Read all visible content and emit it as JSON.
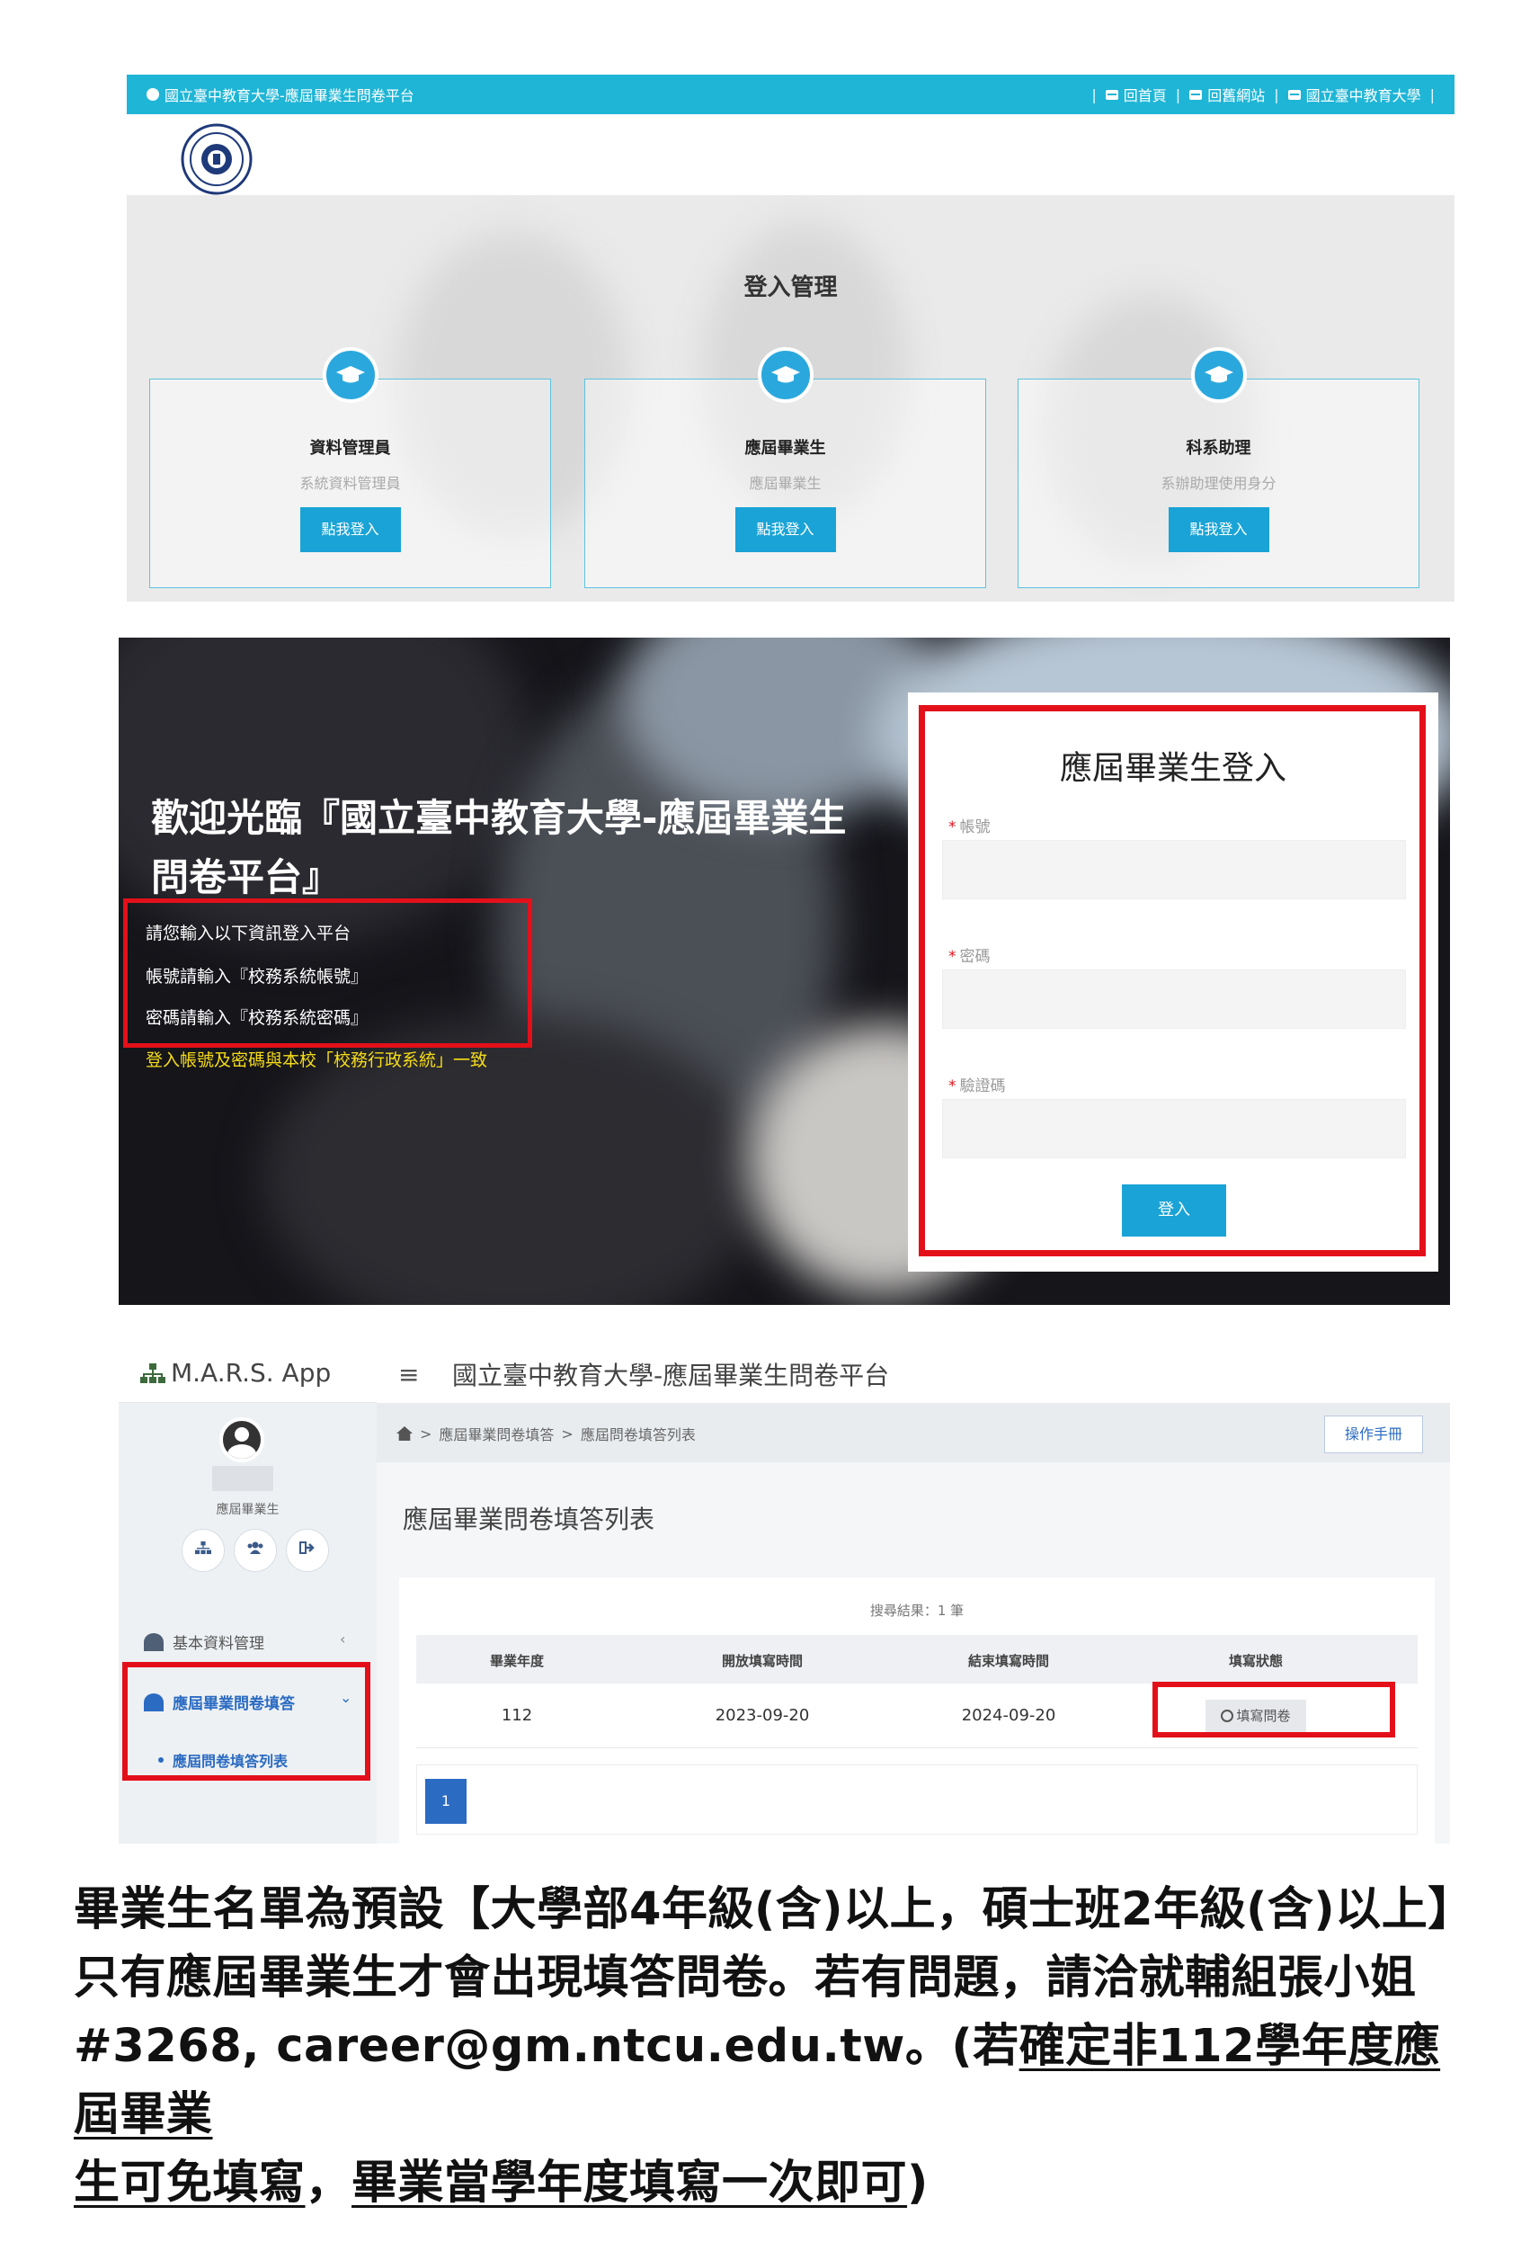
{
  "portal": {
    "site_title": "國立臺中教育大學-應屆畢業生問卷平台",
    "top_links": [
      "回首頁",
      "回舊網站",
      "國立臺中教育大學"
    ],
    "section_title": "登入管理",
    "cards": [
      {
        "title": "資料管理員",
        "subtitle": "系統資料管理員",
        "button": "點我登入"
      },
      {
        "title": "應屆畢業生",
        "subtitle": "應屆畢業生",
        "button": "點我登入"
      },
      {
        "title": "科系助理",
        "subtitle": "系辦助理使用身分",
        "button": "點我登入"
      }
    ]
  },
  "login": {
    "welcome": "歡迎光臨『國立臺中教育大學-應屆畢業生問卷平台』",
    "info": [
      "請您輸入以下資訊登入平台",
      "帳號請輸入『校務系統帳號』",
      "密碼請輸入『校務系統密碼』",
      "登入帳號及密碼與本校「校務行政系統」一致"
    ],
    "panel_title": "應屆畢業生登入",
    "fields": [
      {
        "label": "帳號",
        "value": ""
      },
      {
        "label": "密碼",
        "value": ""
      },
      {
        "label": "驗證碼",
        "value": ""
      }
    ],
    "button": "登入"
  },
  "app": {
    "brand": "M.A.R.S. App",
    "title": "國立臺中教育大學-應屆畢業生問卷平台",
    "role": "應屆畢業生",
    "menu": [
      "基本資料管理",
      "應屆畢業問卷填答"
    ],
    "submenu": "應屆問卷填答列表",
    "breadcrumb": [
      "應屆畢業問卷填答",
      "應屆問卷填答列表"
    ],
    "manual_button": "操作手冊",
    "page_title": "應屆畢業問卷填答列表",
    "result_text": "搜尋結果：1 筆",
    "columns": [
      "畢業年度",
      "開放填寫時間",
      "結束填寫時間",
      "填寫狀態"
    ],
    "rows": [
      {
        "year": "112",
        "open": "2023-09-20",
        "close": "2024-09-20",
        "action": "填寫問卷"
      }
    ],
    "page": "1"
  },
  "notice": {
    "line1": "畢業生名單為預設【大學部4年級(含)以上，碩士班2年級(含)以上】",
    "line2": "只有應屆畢業生才會出現填答問卷。若有問題，請洽就輔組張小姐",
    "line3_plain": "#3268, career@gm.ntcu.edu.tw。(若",
    "line3_u": "確定非112學年度應屆畢業",
    "line4_u1": "生可免填寫",
    "line4_comma": "，",
    "line4_u2": "畢業當學年度填寫一次即可",
    "line4_end": ")"
  },
  "colors": {
    "accent": "#1aa3d6",
    "highlight": "#e3101a",
    "link_blue": "#2b6bc2"
  }
}
